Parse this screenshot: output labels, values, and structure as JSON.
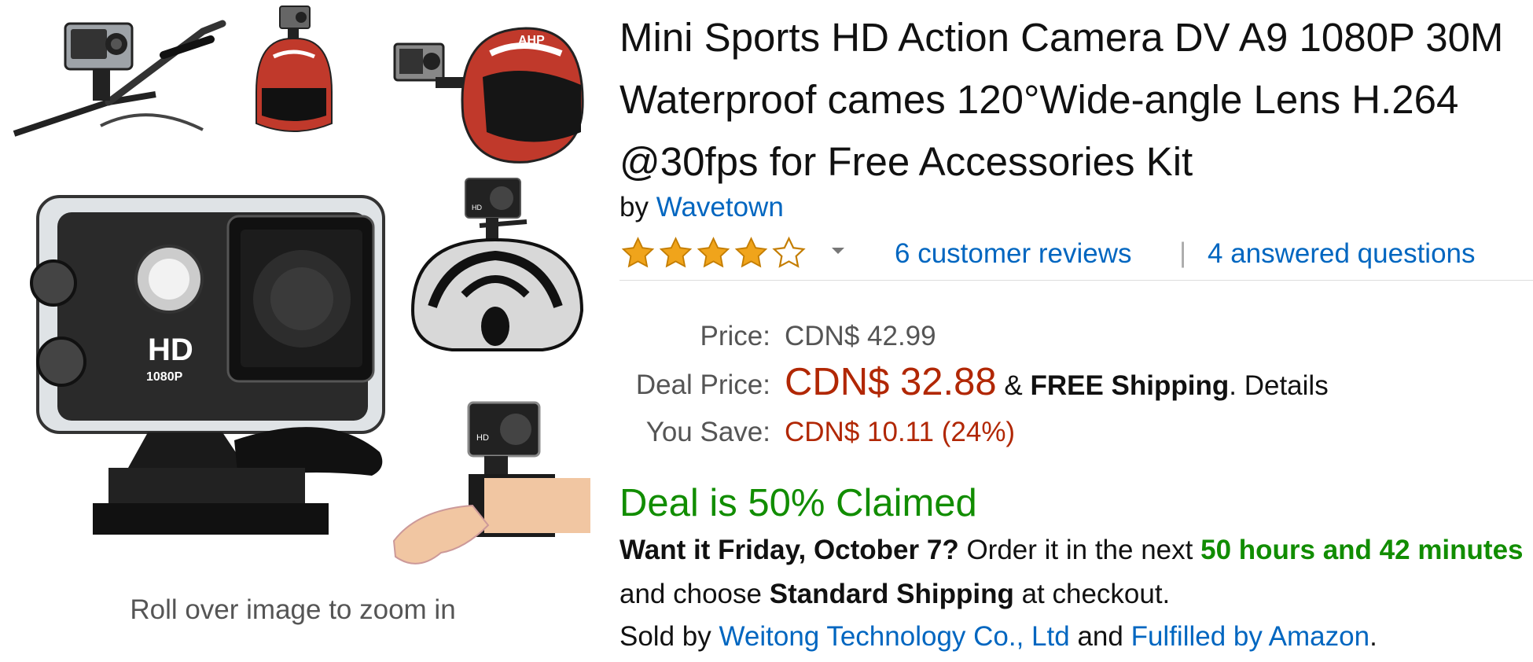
{
  "gallery": {
    "zoom_hint": "Roll over image to zoom in",
    "camera_badge_main": "HD",
    "camera_badge_sub": "1080P",
    "helmet_logo": "AHP"
  },
  "product": {
    "title": "Mini Sports HD Action Camera DV A9 1080P 30M Waterproof cames 120°Wide-angle Lens H.264 @30fps for Free Accessories Kit",
    "by_prefix": "by",
    "brand": "Wavetown"
  },
  "rating": {
    "value": 4,
    "out_of": 5,
    "reviews_label": "6 customer reviews",
    "separator": "|",
    "questions_label": "4 answered questions"
  },
  "pricing": {
    "price_label": "Price:",
    "price_value": "CDN$ 42.99",
    "deal_label": "Deal Price:",
    "deal_value": "CDN$ 32.88",
    "shipping_prefix": "&",
    "shipping_bold": "FREE Shipping",
    "shipping_period": ".",
    "details_link": "Details",
    "save_label": "You Save:",
    "save_value": "CDN$ 10.11 (24%)"
  },
  "deal_status": {
    "claimed_text": "Deal is 50% Claimed"
  },
  "delivery": {
    "want_it": "Want it Friday, October 7?",
    "order_text": "Order it in the next",
    "countdown": "50 hours and 42 minutes",
    "choose_text": "and choose",
    "shipping_option": "Standard Shipping",
    "checkout_text": "at checkout."
  },
  "seller": {
    "sold_by": "Sold by",
    "seller_name": "Weitong Technology Co., Ltd",
    "and_text": "and",
    "fulfilled_by": "Fulfilled by Amazon",
    "period": "."
  },
  "colors": {
    "link": "#0066c0",
    "price_red": "#b12704",
    "deal_green": "#118d00",
    "star_orange": "#f0a41b"
  },
  "icons": [
    "star-icon",
    "half-star-icon",
    "empty-star-icon",
    "chevron-down-icon"
  ]
}
